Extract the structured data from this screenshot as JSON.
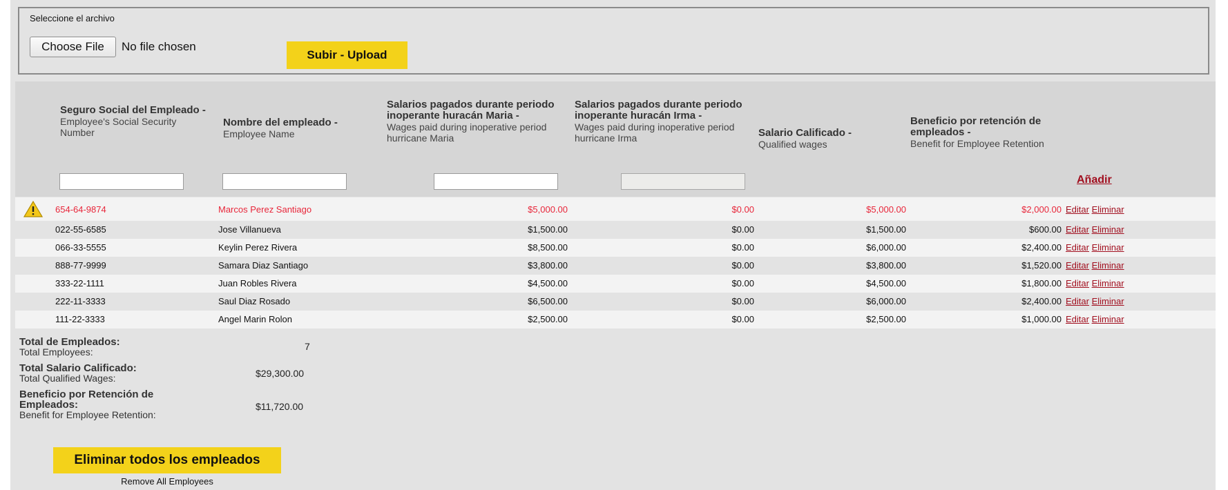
{
  "upload": {
    "label": "Seleccione el archivo",
    "choose_file": "Choose File",
    "file_status": "No file chosen",
    "upload_button": "Subir - Upload"
  },
  "columns": {
    "ssn": {
      "es": "Seguro Social del Empleado -",
      "en": "Employee's Social Security Number"
    },
    "name": {
      "es": "Nombre del empleado -",
      "en": "Employee Name"
    },
    "maria": {
      "es": "Salarios pagados durante periodo inoperante huracán Maria -",
      "en": "Wages paid during inoperative period hurricane Maria"
    },
    "irma": {
      "es": "Salarios pagados durante periodo inoperante huracán Irma -",
      "en": "Wages paid during inoperative period hurricane Irma"
    },
    "qualified": {
      "es": "Salario Calificado -",
      "en": "Qualified wages"
    },
    "benefit": {
      "es": "Beneficio por retención de empleados -",
      "en": "Benefit for Employee Retention"
    }
  },
  "add_link": "Añadir",
  "actions": {
    "edit": "Editar",
    "delete": "Eliminar"
  },
  "rows": [
    {
      "ssn": "654-64-9874",
      "name": "Marcos Perez Santiago",
      "maria": "$5,000.00",
      "irma": "$0.00",
      "qualified": "$5,000.00",
      "benefit": "$2,000.00",
      "warning": true
    },
    {
      "ssn": "022-55-6585",
      "name": "Jose Villanueva",
      "maria": "$1,500.00",
      "irma": "$0.00",
      "qualified": "$1,500.00",
      "benefit": "$600.00",
      "warning": false
    },
    {
      "ssn": "066-33-5555",
      "name": "Keylin Perez Rivera",
      "maria": "$8,500.00",
      "irma": "$0.00",
      "qualified": "$6,000.00",
      "benefit": "$2,400.00",
      "warning": false
    },
    {
      "ssn": "888-77-9999",
      "name": "Samara Diaz Santiago",
      "maria": "$3,800.00",
      "irma": "$0.00",
      "qualified": "$3,800.00",
      "benefit": "$1,520.00",
      "warning": false
    },
    {
      "ssn": "333-22-1111",
      "name": "Juan Robles Rivera",
      "maria": "$4,500.00",
      "irma": "$0.00",
      "qualified": "$4,500.00",
      "benefit": "$1,800.00",
      "warning": false
    },
    {
      "ssn": "222-11-3333",
      "name": "Saul Diaz Rosado",
      "maria": "$6,500.00",
      "irma": "$0.00",
      "qualified": "$6,000.00",
      "benefit": "$2,400.00",
      "warning": false
    },
    {
      "ssn": "111-22-3333",
      "name": "Angel Marin Rolon",
      "maria": "$2,500.00",
      "irma": "$0.00",
      "qualified": "$2,500.00",
      "benefit": "$1,000.00",
      "warning": false
    }
  ],
  "totals": {
    "employees": {
      "es": "Total de Empleados:",
      "en": "Total Employees:",
      "value": "7"
    },
    "qualified": {
      "es": "Total Salario Calificado:",
      "en": "Total Qualified Wages:",
      "value": "$29,300.00"
    },
    "benefit": {
      "es_line1": "Beneficio por Retención de",
      "es_line2": "Empleados:",
      "en": "Benefit for Employee Retention:",
      "value": "$11,720.00"
    }
  },
  "remove_all": {
    "button": "Eliminar todos los empleados",
    "sub": "Remove All Employees"
  },
  "colors": {
    "accent_yellow": "#f3d21a",
    "link_red": "#a10e1e",
    "warning_red": "#e8263a"
  },
  "icons": {
    "warning": "warning-triangle-icon"
  }
}
